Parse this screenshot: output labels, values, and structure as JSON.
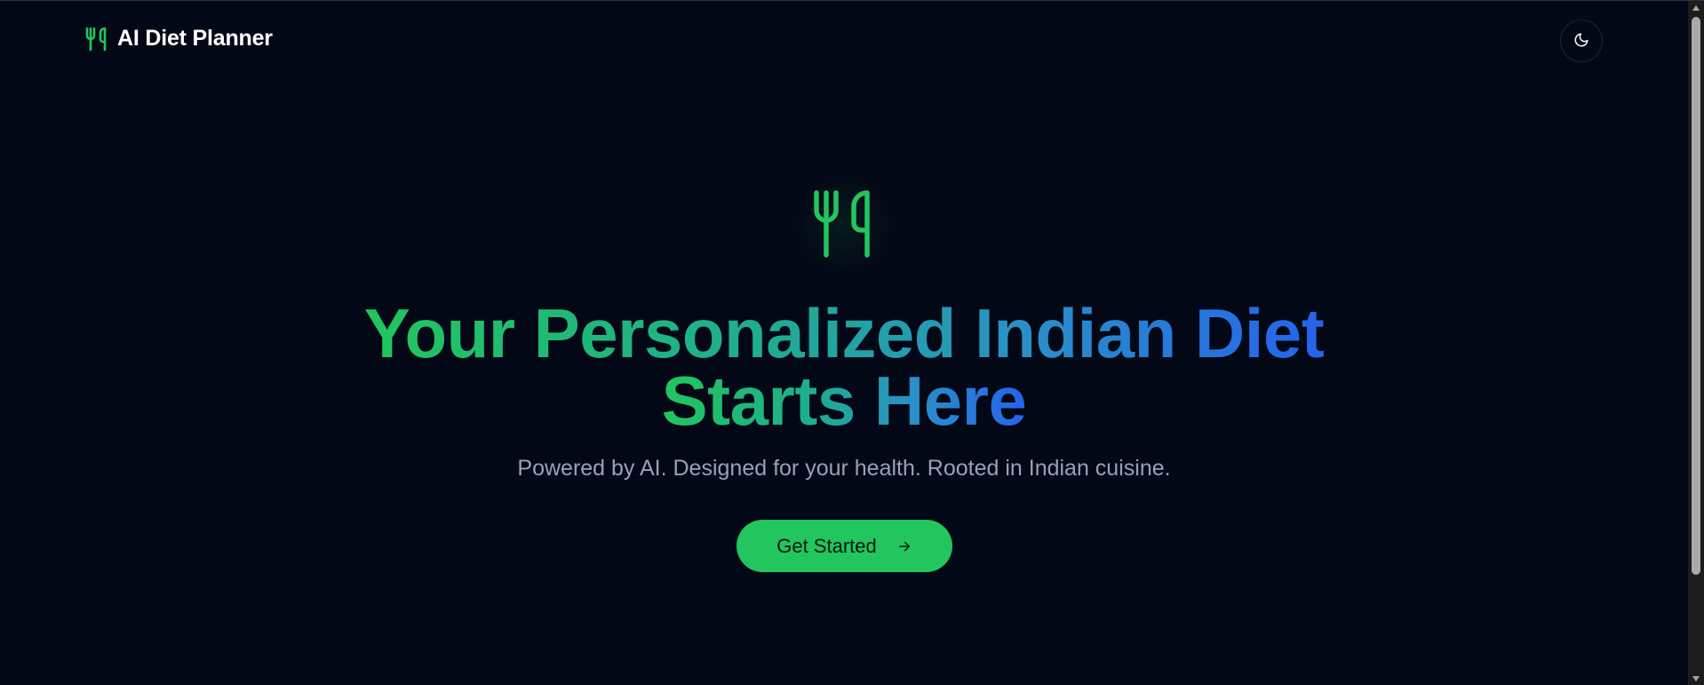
{
  "header": {
    "brand_icon": "utensils-icon",
    "brand_title": "AI Diet Planner",
    "theme_toggle_icon": "moon-icon"
  },
  "hero": {
    "icon": "utensils-icon",
    "title_line1": "Your Personalized Indian Diet",
    "title_line2": "Starts Here",
    "subtitle": "Powered by AI. Designed for your health. Rooted in Indian cuisine.",
    "cta_label": "Get Started",
    "cta_icon": "arrow-right-icon"
  },
  "colors": {
    "background": "#030816",
    "accent_green": "#22c55e",
    "accent_blue": "#2563eb",
    "subtitle": "#94a3b8"
  }
}
